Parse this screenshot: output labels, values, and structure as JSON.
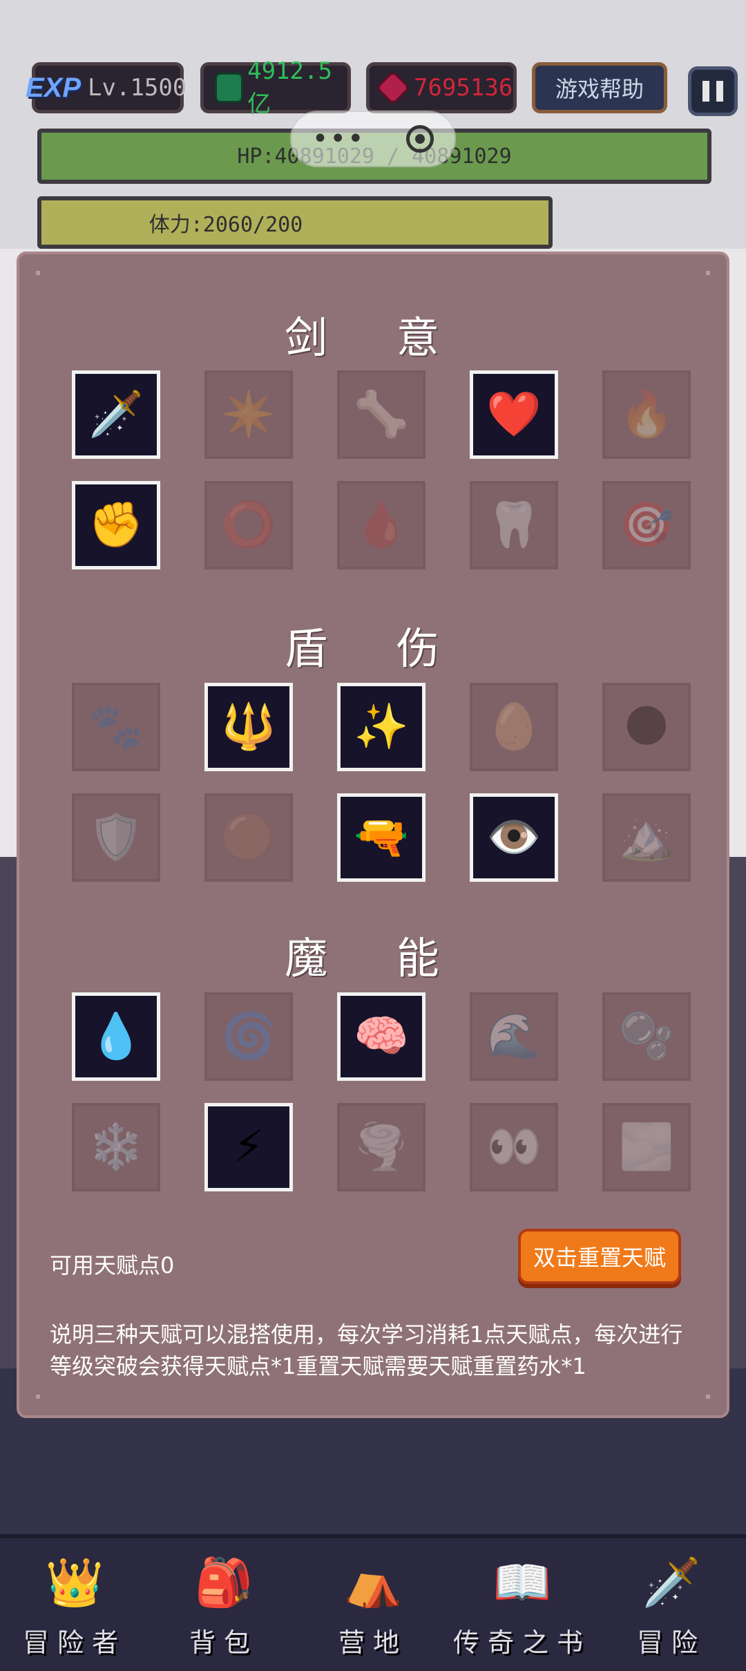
{
  "hud": {
    "exp_badge": "EXP",
    "level": "Lv.1500",
    "gold": "4912.5亿",
    "gems": "7695136",
    "help_label": "游戏帮助",
    "hp_text": "HP:40891029 / 40891029",
    "stamina_text": "体力:2060/200"
  },
  "colors": {
    "hp_bar": "#6b9a4f",
    "stamina_bar": "#b1b05a",
    "panel": "#8f7277",
    "reset_button": "#f07a1a"
  },
  "sections": [
    {
      "title": "剑 意",
      "slots": [
        {
          "icon": "🗡️",
          "name": "chain-sword-icon",
          "active": true
        },
        {
          "icon": "✴️",
          "name": "starfish-icon",
          "active": false
        },
        {
          "icon": "🦴",
          "name": "bone-icon",
          "active": false
        },
        {
          "icon": "❤️",
          "name": "heart-icon",
          "active": true
        },
        {
          "icon": "🔥",
          "name": "claw-flame-icon",
          "active": false
        },
        {
          "icon": "✊",
          "name": "fist-icon",
          "active": true
        },
        {
          "icon": "⭕",
          "name": "ring-icon",
          "active": false
        },
        {
          "icon": "🩸",
          "name": "blood-drops-icon",
          "active": false
        },
        {
          "icon": "🦷",
          "name": "fangs-icon",
          "active": false
        },
        {
          "icon": "🎯",
          "name": "crosshair-icon",
          "active": false
        }
      ]
    },
    {
      "title": "盾 伤",
      "slots": [
        {
          "icon": "🐾",
          "name": "paw-icon",
          "active": false
        },
        {
          "icon": "🔱",
          "name": "fire-trident-icon",
          "active": true
        },
        {
          "icon": "✨",
          "name": "star-ring-icon",
          "active": true
        },
        {
          "icon": "🥚",
          "name": "orb-icon",
          "active": false
        },
        {
          "icon": "🌑",
          "name": "shadow-orb-icon",
          "active": false
        },
        {
          "icon": "🛡️",
          "name": "shield-rune-icon",
          "active": false
        },
        {
          "icon": "🟤",
          "name": "boulders-icon",
          "active": false
        },
        {
          "icon": "🔫",
          "name": "bullet-icon",
          "active": true
        },
        {
          "icon": "👁️",
          "name": "fire-eye-icon",
          "active": true
        },
        {
          "icon": "🏔️",
          "name": "mountain-icon",
          "active": false
        }
      ]
    },
    {
      "title": "魔 能",
      "slots": [
        {
          "icon": "💧",
          "name": "ice-crystals-icon",
          "active": true
        },
        {
          "icon": "🌀",
          "name": "swirl-icon",
          "active": false
        },
        {
          "icon": "🧠",
          "name": "brain-icon",
          "active": true
        },
        {
          "icon": "🌊",
          "name": "wave-icon",
          "active": false
        },
        {
          "icon": "🫧",
          "name": "bubbles-icon",
          "active": false
        },
        {
          "icon": "❄️",
          "name": "frost-spike-icon",
          "active": false
        },
        {
          "icon": "⚡",
          "name": "ice-slash-icon",
          "active": true
        },
        {
          "icon": "🌪️",
          "name": "vortex-icon",
          "active": false
        },
        {
          "icon": "👀",
          "name": "shadow-eyes-icon",
          "active": false
        },
        {
          "icon": "🌫️",
          "name": "mist-orb-icon",
          "active": false
        }
      ]
    }
  ],
  "talent_points": "可用天赋点0",
  "reset_label": "双击重置天赋",
  "description": "说明三种天赋可以混搭使用，每次学习消耗1点天赋点，每次进行等级突破会获得天赋点*1重置天赋需要天赋重置药水*1",
  "nav": [
    {
      "icon": "👑",
      "name": "nav-adventurer",
      "label": "冒险者"
    },
    {
      "icon": "🎒",
      "name": "nav-bag",
      "label": "背包"
    },
    {
      "icon": "⛺",
      "name": "nav-camp",
      "label": "营地"
    },
    {
      "icon": "📖",
      "name": "nav-legend-book",
      "label": "传奇之书"
    },
    {
      "icon": "🗡️",
      "name": "nav-adventure",
      "label": "冒险"
    }
  ]
}
